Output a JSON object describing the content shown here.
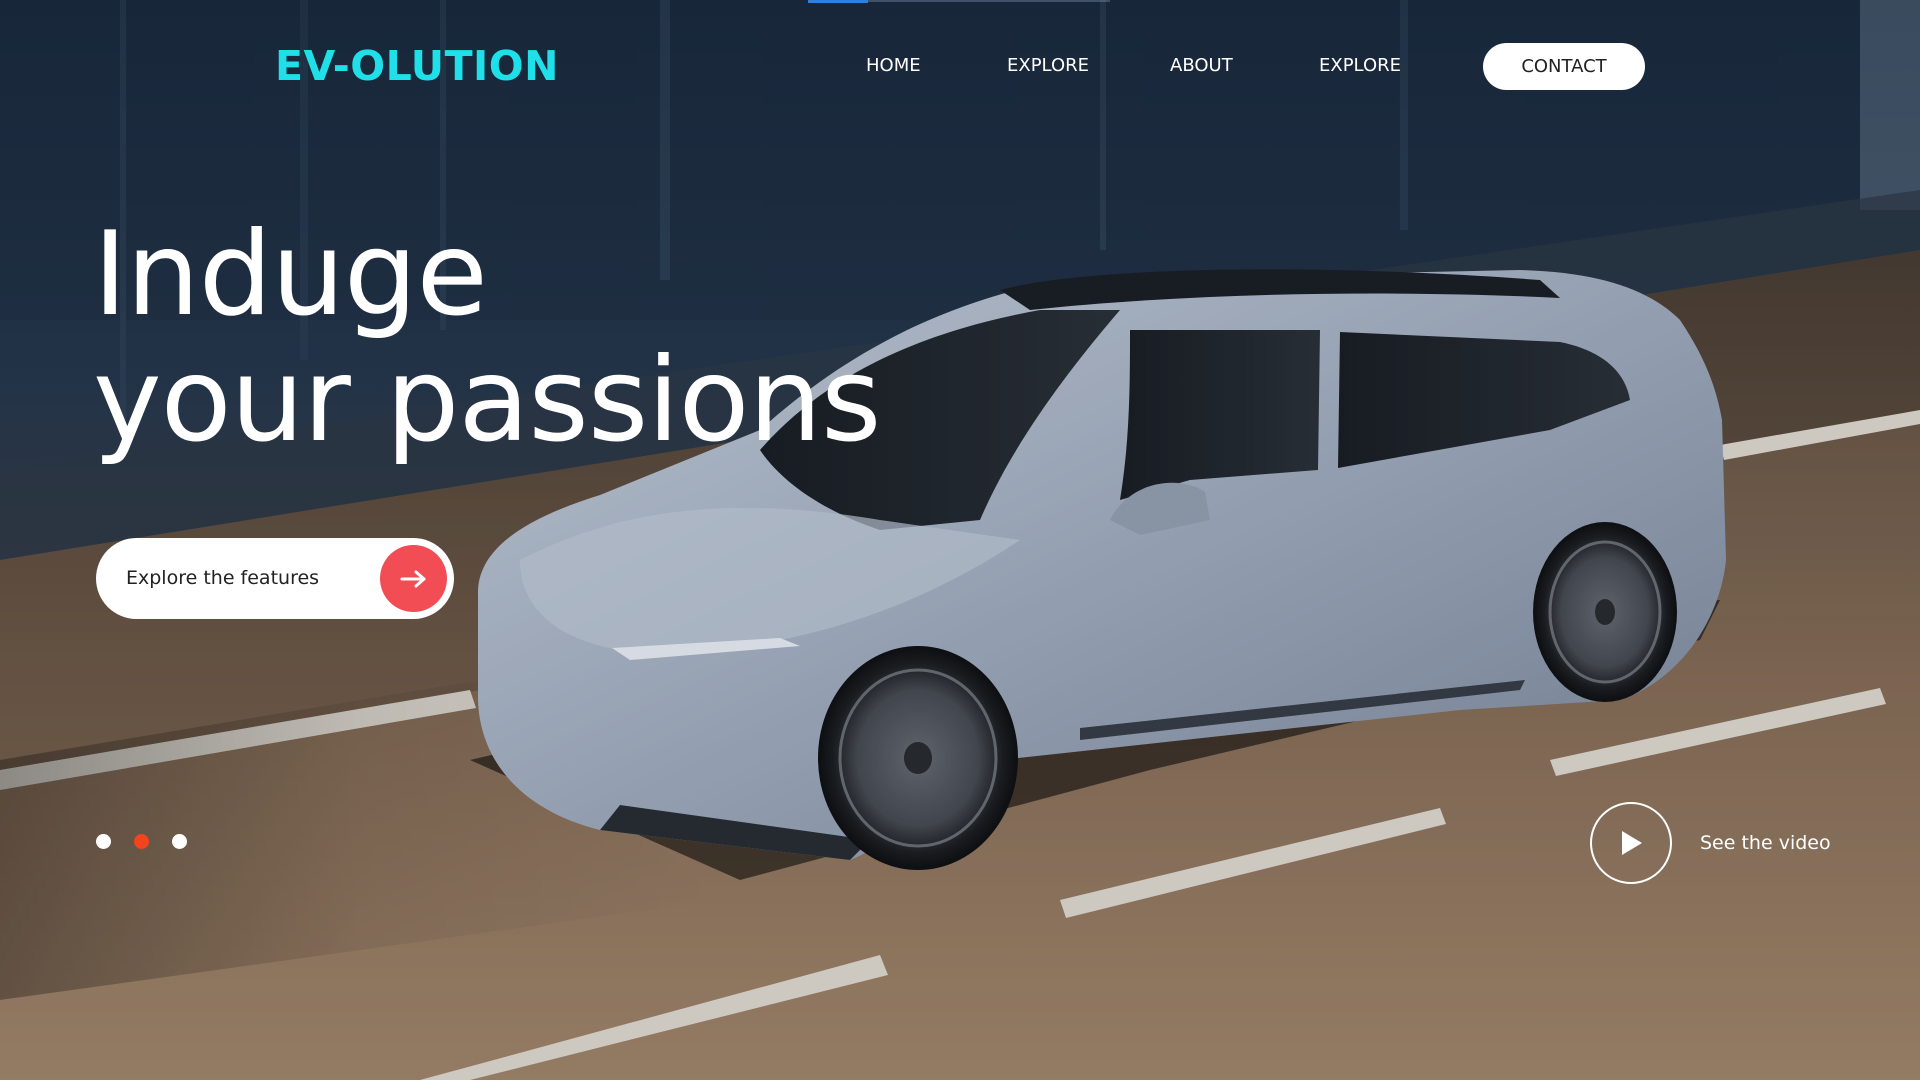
{
  "brand": {
    "logo_text": "EV-OLUTION",
    "logo_color": "#1fe0e8",
    "accent_color": "#f24d55",
    "active_dot_color": "#f2441e"
  },
  "nav": {
    "items": [
      {
        "label": "HOME"
      },
      {
        "label": "EXPLORE"
      },
      {
        "label": "ABOUT"
      },
      {
        "label": "EXPLORE"
      }
    ],
    "contact_label": "CONTACT"
  },
  "hero": {
    "headline_line1": "Induge",
    "headline_line2": "your passions",
    "cta_label": "Explore the features",
    "cta_icon": "arrow-right-icon",
    "slides": {
      "count": 3,
      "active_index": 1
    },
    "video_label": "See the video",
    "video_icon": "play-icon",
    "background": "photo of a light blue electric station wagon driving on a road"
  }
}
